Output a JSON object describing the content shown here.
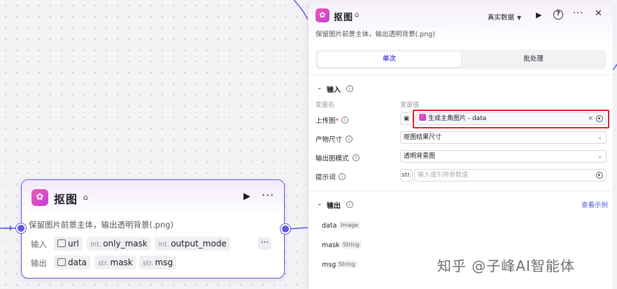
{
  "colors": {
    "accent": "#5e58e0",
    "plugin_gradient_start": "#f05ab4",
    "plugin_gradient_end": "#c13fd6",
    "highlight_border": "#e3202a",
    "link": "#4a59d6"
  },
  "node": {
    "icon": "plugin-icon",
    "title": "抠图",
    "description": "保留图片前景主体，输出透明背景(.png)",
    "input_label": "输入",
    "output_label": "输出",
    "inputs": [
      {
        "type": "",
        "name": "url",
        "icon": "image-icon"
      },
      {
        "type": "int.",
        "name": "only_mask"
      },
      {
        "type": "int.",
        "name": "output_mode"
      }
    ],
    "outputs": [
      {
        "type": "",
        "name": "data",
        "icon": "image-icon"
      },
      {
        "type": "str.",
        "name": "mask"
      },
      {
        "type": "str.",
        "name": "msg"
      }
    ],
    "more_label": "···"
  },
  "panel": {
    "title": "抠图",
    "description": "保留图片前景主体，输出透明背景(.png)",
    "data_mode": "真实数据",
    "tabs": [
      {
        "label": "单次",
        "active": true
      },
      {
        "label": "批处理",
        "active": false
      }
    ],
    "input_section": {
      "title": "输入",
      "col_name": "变量名",
      "col_value": "变量值",
      "params": [
        {
          "name": "上传图",
          "required_mark": "*",
          "value": "生成主角图片 - data",
          "kind": "reference"
        },
        {
          "name": "产物尺寸",
          "value": "抠图结果尺寸",
          "kind": "select"
        },
        {
          "name": "输出图模式",
          "value": "透明背景图",
          "kind": "select"
        },
        {
          "name": "提示词",
          "type_label": "str.",
          "placeholder": "输入或引用参数值",
          "kind": "text"
        }
      ]
    },
    "output_section": {
      "title": "输出",
      "example_link": "查看示例",
      "outputs": [
        {
          "name": "data",
          "type": "Image"
        },
        {
          "name": "mask",
          "type": "String"
        },
        {
          "name": "msg",
          "type": "String"
        }
      ]
    }
  },
  "watermark": "知乎 @子峰AI智能体"
}
